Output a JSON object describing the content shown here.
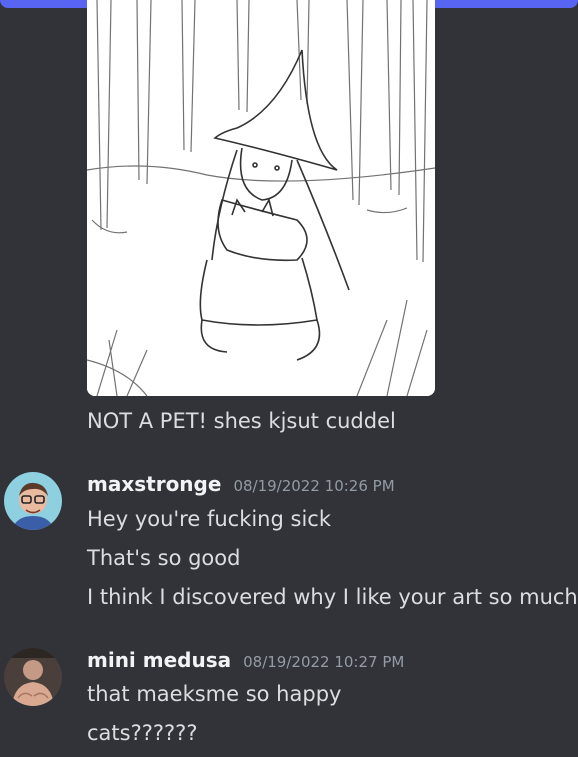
{
  "colors": {
    "background": "#313338",
    "accent": "#5865f2",
    "text": "#dbdee1",
    "author": "#f2f3f5",
    "timestamp": "#949ba4"
  },
  "attachment": {
    "icon": "witch-sketch-image"
  },
  "caption": "NOT A PET! shes kjsut cuddel",
  "messages": [
    {
      "author": "maxstronge",
      "timestamp": "08/19/2022 10:26 PM",
      "lines": [
        "Hey you're fucking sick",
        "That's so good",
        "I think I discovered why I like your art so much!!"
      ]
    },
    {
      "author": "mini medusa",
      "timestamp": "08/19/2022 10:27 PM",
      "lines": [
        "that maeksme so happy",
        "cats??????"
      ]
    }
  ]
}
